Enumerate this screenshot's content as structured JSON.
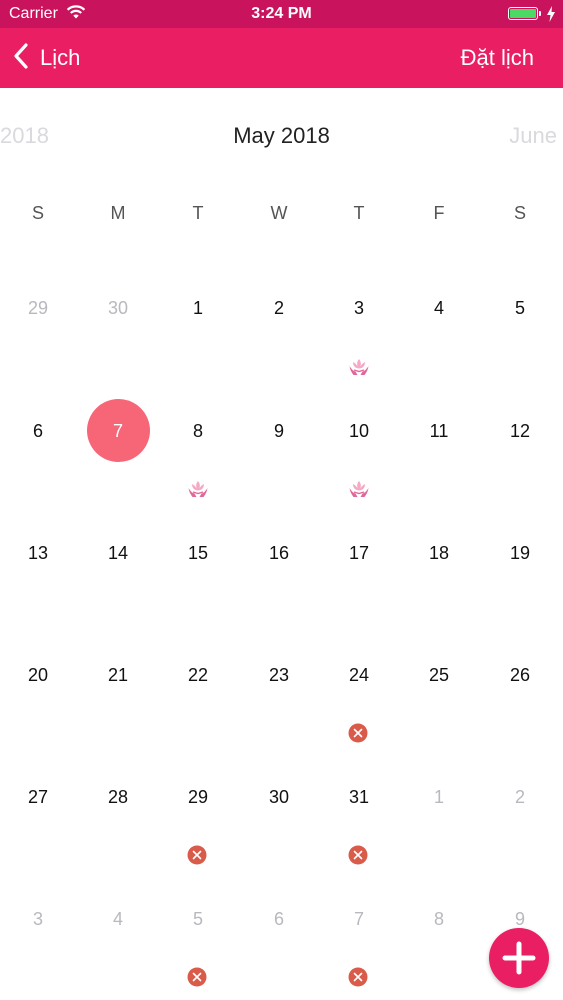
{
  "status_bar": {
    "carrier": "Carrier",
    "time": "3:24 PM"
  },
  "nav": {
    "back_label": "Lịch",
    "action_label": "Đặt lịch"
  },
  "calendar": {
    "prev_label": "2018",
    "month_title": "May 2018",
    "next_label": "June",
    "weekdays": [
      "S",
      "M",
      "T",
      "W",
      "T",
      "F",
      "S"
    ],
    "weeks": [
      [
        "29",
        "30",
        "1",
        "2",
        "3",
        "4",
        "5"
      ],
      [
        "6",
        "7",
        "8",
        "9",
        "10",
        "11",
        "12"
      ],
      [
        "13",
        "14",
        "15",
        "16",
        "17",
        "18",
        "19"
      ],
      [
        "20",
        "21",
        "22",
        "23",
        "24",
        "25",
        "26"
      ],
      [
        "27",
        "28",
        "29",
        "30",
        "31",
        "1",
        "2"
      ],
      [
        "3",
        "4",
        "5",
        "6",
        "7",
        "8",
        "9"
      ]
    ],
    "other_month": [
      [
        true,
        true,
        false,
        false,
        false,
        false,
        false
      ],
      [
        false,
        false,
        false,
        false,
        false,
        false,
        false
      ],
      [
        false,
        false,
        false,
        false,
        false,
        false,
        false
      ],
      [
        false,
        false,
        false,
        false,
        false,
        false,
        false
      ],
      [
        false,
        false,
        false,
        false,
        false,
        true,
        true
      ],
      [
        true,
        true,
        true,
        true,
        true,
        true,
        true
      ]
    ],
    "selected": {
      "week": 1,
      "day": 1
    },
    "markers": [
      {
        "week": 0,
        "day": 4,
        "icon": "lotus-hands-icon"
      },
      {
        "week": 1,
        "day": 2,
        "icon": "lotus-hands-icon"
      },
      {
        "week": 1,
        "day": 4,
        "icon": "lotus-hands-icon"
      },
      {
        "week": 3,
        "day": 4,
        "icon": "cancelled-x-icon"
      },
      {
        "week": 4,
        "day": 2,
        "icon": "cancelled-x-icon"
      },
      {
        "week": 4,
        "day": 4,
        "icon": "cancelled-x-icon"
      },
      {
        "week": 5,
        "day": 2,
        "icon": "cancelled-x-icon"
      },
      {
        "week": 5,
        "day": 4,
        "icon": "cancelled-x-icon"
      }
    ]
  },
  "colors": {
    "nav_bar": "#e91e63",
    "status_bar": "#c9135c",
    "selected_day": "#f76677",
    "cancelled": "#d95b4a",
    "lotus": "#e0679a"
  },
  "fab": {
    "icon": "plus-icon"
  }
}
